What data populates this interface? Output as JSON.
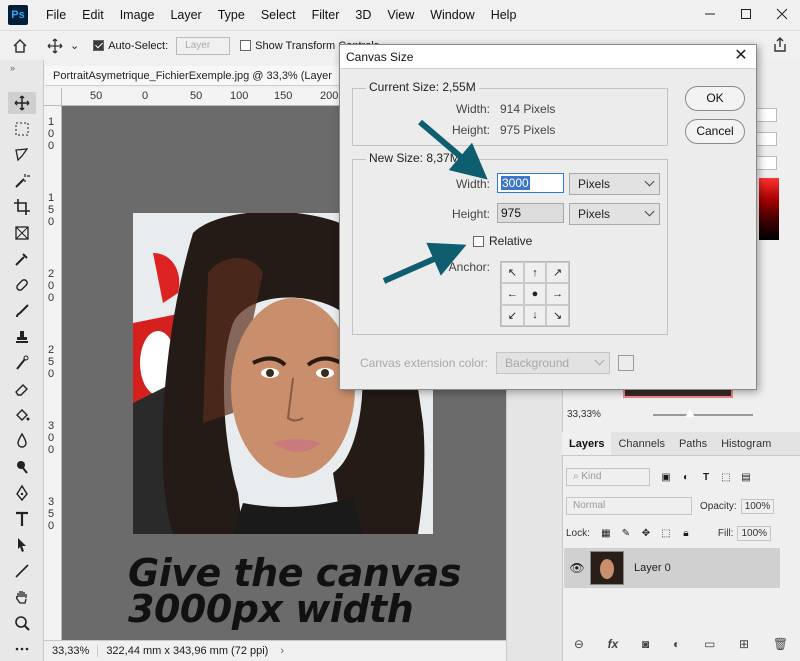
{
  "app": {
    "logo": "Ps"
  },
  "menu": [
    "File",
    "Edit",
    "Image",
    "Layer",
    "Type",
    "Select",
    "Filter",
    "3D",
    "View",
    "Window",
    "Help"
  ],
  "options_bar": {
    "auto_select_label": "Auto-Select:",
    "auto_select_value": "Layer",
    "transform_label": "Show Transform Controls"
  },
  "document": {
    "tab_title": "PortraitAsymetrique_FichierExemple.jpg @ 33,3% (Layer",
    "ruler_h_ticks": [
      "50",
      "0",
      "50",
      "100",
      "150",
      "200"
    ],
    "ruler_v_ticks": [
      "1",
      "0",
      "0",
      "1",
      "5",
      "0",
      "2",
      "0",
      "0",
      "2",
      "5",
      "0",
      "3",
      "0",
      "0",
      "3",
      "5",
      "0"
    ],
    "zoom": "33,33%",
    "size_info": "322,44 mm x 343,96 mm (72 ppi)"
  },
  "caption": {
    "line1": "Give the canvas",
    "line2": "3000px width"
  },
  "dialog": {
    "title": "Canvas Size",
    "current_size": {
      "legend": "Current Size: 2,55M",
      "width_label": "Width:",
      "width_value": "914 Pixels",
      "height_label": "Height:",
      "height_value": "975 Pixels"
    },
    "new_size": {
      "legend": "New Size: 8,37M",
      "width_label": "Width:",
      "width_value": "3000",
      "width_unit": "Pixels",
      "height_label": "Height:",
      "height_value": "975",
      "height_unit": "Pixels",
      "relative_label": "Relative",
      "anchor_label": "Anchor:"
    },
    "extension_label": "Canvas extension color:",
    "extension_value": "Background",
    "ok_label": "OK",
    "cancel_label": "Cancel",
    "arrow_color": "#0e5e70"
  },
  "right_panel": {
    "zoom_value": "33,33%",
    "tabs": [
      "Layers",
      "Channels",
      "Paths",
      "Histogram"
    ],
    "kind_label": "Kind",
    "blend_mode": "Normal",
    "opacity_label": "Opacity:",
    "opacity_value": "100%",
    "lock_label": "Lock:",
    "fill_label": "Fill:",
    "fill_value": "100%",
    "layer_name": "Layer 0"
  }
}
